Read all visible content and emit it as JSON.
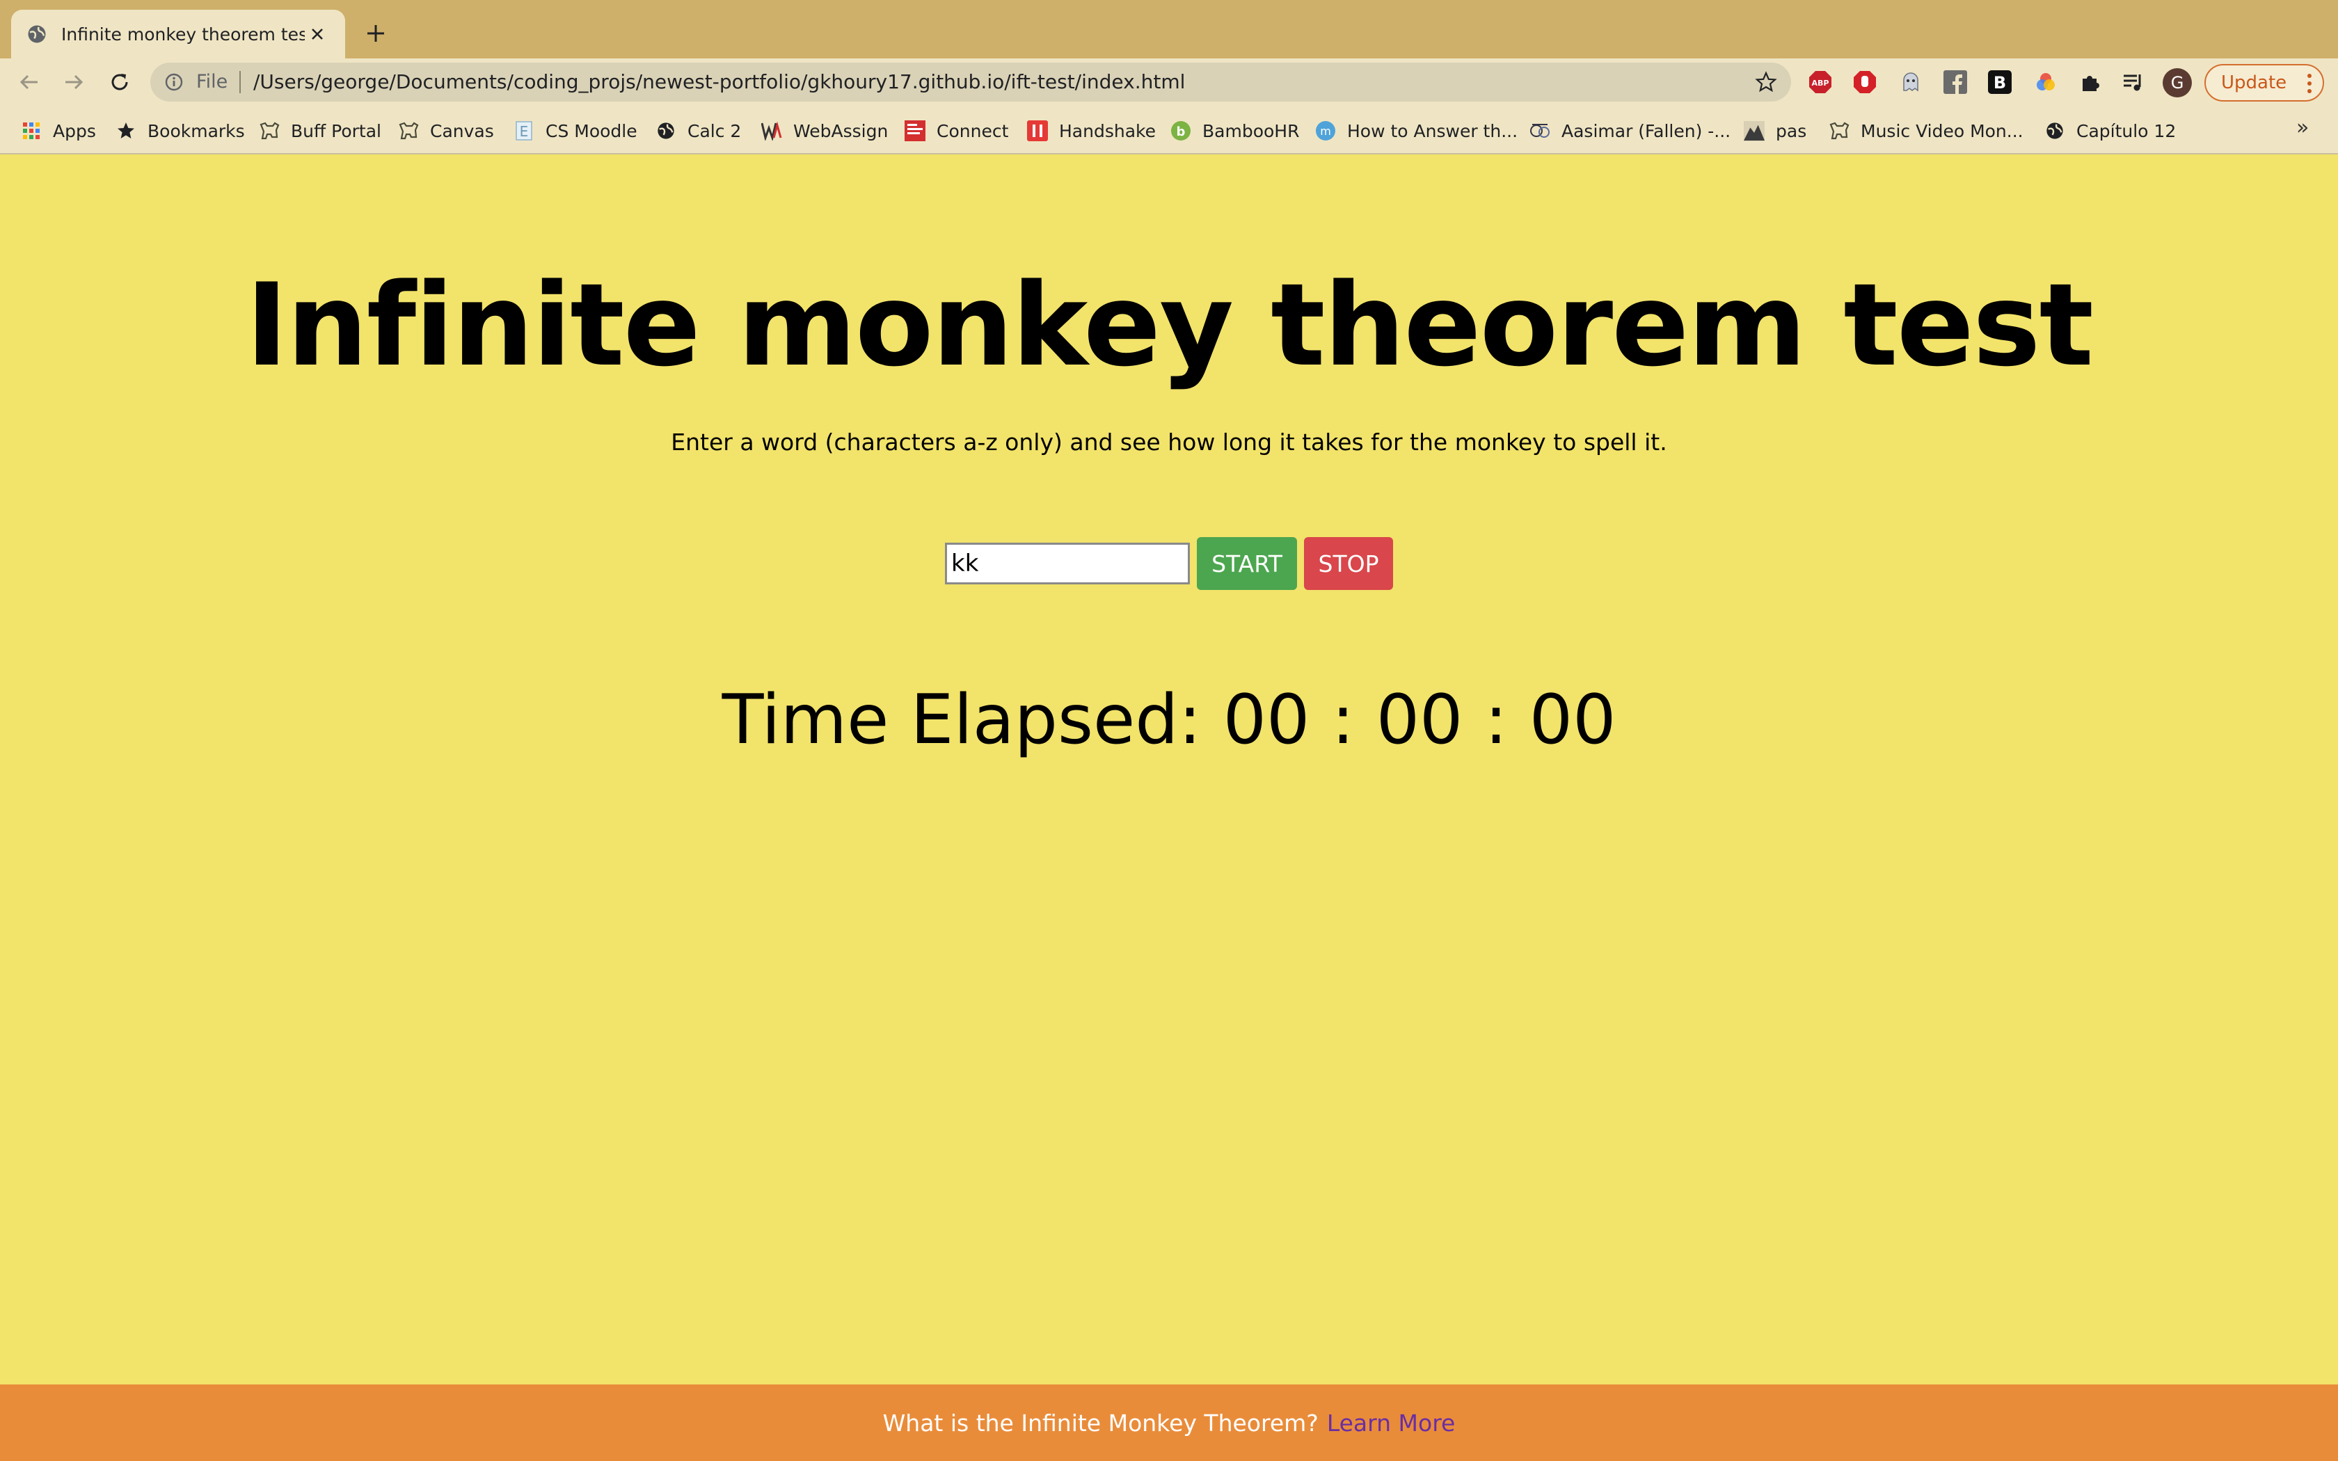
{
  "browser": {
    "tab_title": "Infinite monkey theorem test",
    "file_label": "File",
    "url": "/Users/george/Documents/coding_projs/newest-portfolio/gkhoury17.github.io/ift-test/index.html",
    "profile_initial": "G",
    "update_label": "Update",
    "extensions": [
      "adblock-plus-icon",
      "stop-hand-icon",
      "ghost-icon",
      "facebook-icon",
      "b-icon",
      "color-wheel-icon",
      "puzzle-icon",
      "queue-icon"
    ],
    "bookmarks": [
      {
        "label": "Apps",
        "icon": "apps-grid-icon"
      },
      {
        "label": "Bookmarks",
        "icon": "star-icon"
      },
      {
        "label": "Buff Portal",
        "icon": "buffalo-icon"
      },
      {
        "label": "Canvas",
        "icon": "buffalo-icon"
      },
      {
        "label": "CS Moodle",
        "icon": "moodle-icon"
      },
      {
        "label": "Calc 2",
        "icon": "globe-icon"
      },
      {
        "label": "WebAssign",
        "icon": "webassign-icon"
      },
      {
        "label": "Connect",
        "icon": "connect-icon"
      },
      {
        "label": "Handshake",
        "icon": "handshake-icon"
      },
      {
        "label": "BambooHR",
        "icon": "bamboo-icon"
      },
      {
        "label": "How to Answer th...",
        "icon": "m-circle-icon"
      },
      {
        "label": "Aasimar (Fallen) -...",
        "icon": "dnd-icon"
      },
      {
        "label": "pas",
        "icon": "mountain-icon"
      },
      {
        "label": "Music Video Mon...",
        "icon": "buffalo-icon"
      },
      {
        "label": "Capítulo 12",
        "icon": "globe-icon"
      }
    ],
    "more_label": "»"
  },
  "page": {
    "title": "Infinite monkey theorem test",
    "instructions": "Enter a word (characters a-z only) and see how long it takes for the monkey to spell it.",
    "input_value": "kk",
    "start_label": "START",
    "stop_label": "STOP",
    "timer_label": "Time Elapsed: 00 : 00 : 00"
  },
  "footer": {
    "question": "What is the Infinite Monkey Theorem?",
    "link_label": "Learn More"
  },
  "colors": {
    "page_bg": "#f2e36a",
    "footer_bg": "#e98c3a",
    "start_button": "#4ca64f",
    "stop_button": "#d9464b",
    "link": "#6a2ea3"
  }
}
